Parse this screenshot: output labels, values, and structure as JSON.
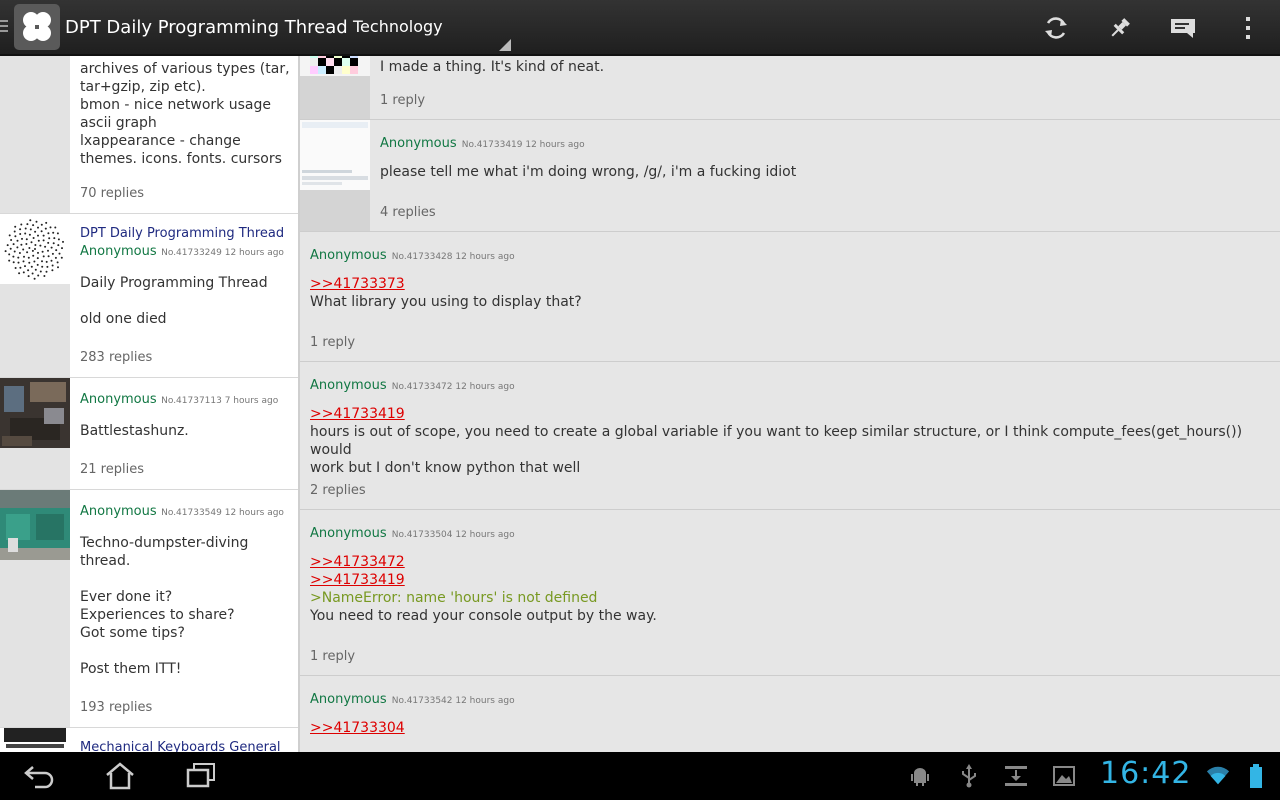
{
  "action_bar": {
    "title": "DPT Daily Programming Thread",
    "board": "Technology"
  },
  "threads": [
    {
      "lines": [
        "archives of various types (tar,",
        "tar+gzip, zip etc).",
        "bmon - nice network usage",
        "ascii graph",
        "lxappearance - change",
        "themes. icons. fonts. cursors"
      ],
      "replies": "70 replies"
    },
    {
      "subject": "DPT Daily Programming Thread",
      "poster": "Anonymous",
      "meta": "No.41733249 12 hours ago",
      "lines": [
        "Daily Programming Thread",
        "",
        "old one died"
      ],
      "replies": "283 replies"
    },
    {
      "poster": "Anonymous",
      "meta": "No.41737113 7 hours ago",
      "lines": [
        "Battlestashunz."
      ],
      "replies": "21 replies"
    },
    {
      "poster": "Anonymous",
      "meta": "No.41733549 12 hours ago",
      "lines": [
        "Techno-dumpster-diving",
        "thread.",
        "",
        "Ever done it?",
        "Experiences to share?",
        "Got some tips?",
        "",
        "Post them ITT!"
      ],
      "replies": "193 replies"
    },
    {
      "subject": "Mechanical Keyboards General"
    }
  ],
  "posts": [
    {
      "text": "I made a thing. It's kind of neat.",
      "replies": "1 reply"
    },
    {
      "poster": "Anonymous",
      "meta": "No.41733419 12 hours ago",
      "text": "please tell me what i'm doing wrong, /g/, i'm a fucking idiot",
      "replies": "4 replies"
    },
    {
      "poster": "Anonymous",
      "meta": "No.41733428 12 hours ago",
      "quotes": [
        ">>41733373"
      ],
      "lines": [
        "What library you using to display that?"
      ],
      "replies": "1 reply"
    },
    {
      "poster": "Anonymous",
      "meta": "No.41733472 12 hours ago",
      "quotes": [
        ">>41733419"
      ],
      "lines": [
        "hours is out of scope, you need to create a global variable if you want to keep similar structure, or I think compute_fees(get_hours()) would",
        "work but I don't know python that well"
      ],
      "replies": "2 replies"
    },
    {
      "poster": "Anonymous",
      "meta": "No.41733504 12 hours ago",
      "quotes": [
        ">>41733472",
        ">>41733419"
      ],
      "greentext": ">NameError: name 'hours' is not defined",
      "lines": [
        "You need to read your console output by the way."
      ],
      "replies": "1 reply"
    },
    {
      "poster": "Anonymous",
      "meta": "No.41733542 12 hours ago",
      "quotes": [
        ">>41733304"
      ]
    }
  ],
  "status_bar": {
    "time": "16:42"
  },
  "icons": {
    "refresh": "refresh-icon",
    "pin": "pin-icon",
    "reply": "reply-icon",
    "overflow": "overflow-icon",
    "back": "back-icon",
    "home": "home-icon",
    "recents": "recents-icon"
  },
  "colors": {
    "poster": "#117743",
    "subject": "#1f2a80",
    "quotelink": "#dd0000",
    "greentext": "#789922",
    "clock": "#33b5e5"
  }
}
